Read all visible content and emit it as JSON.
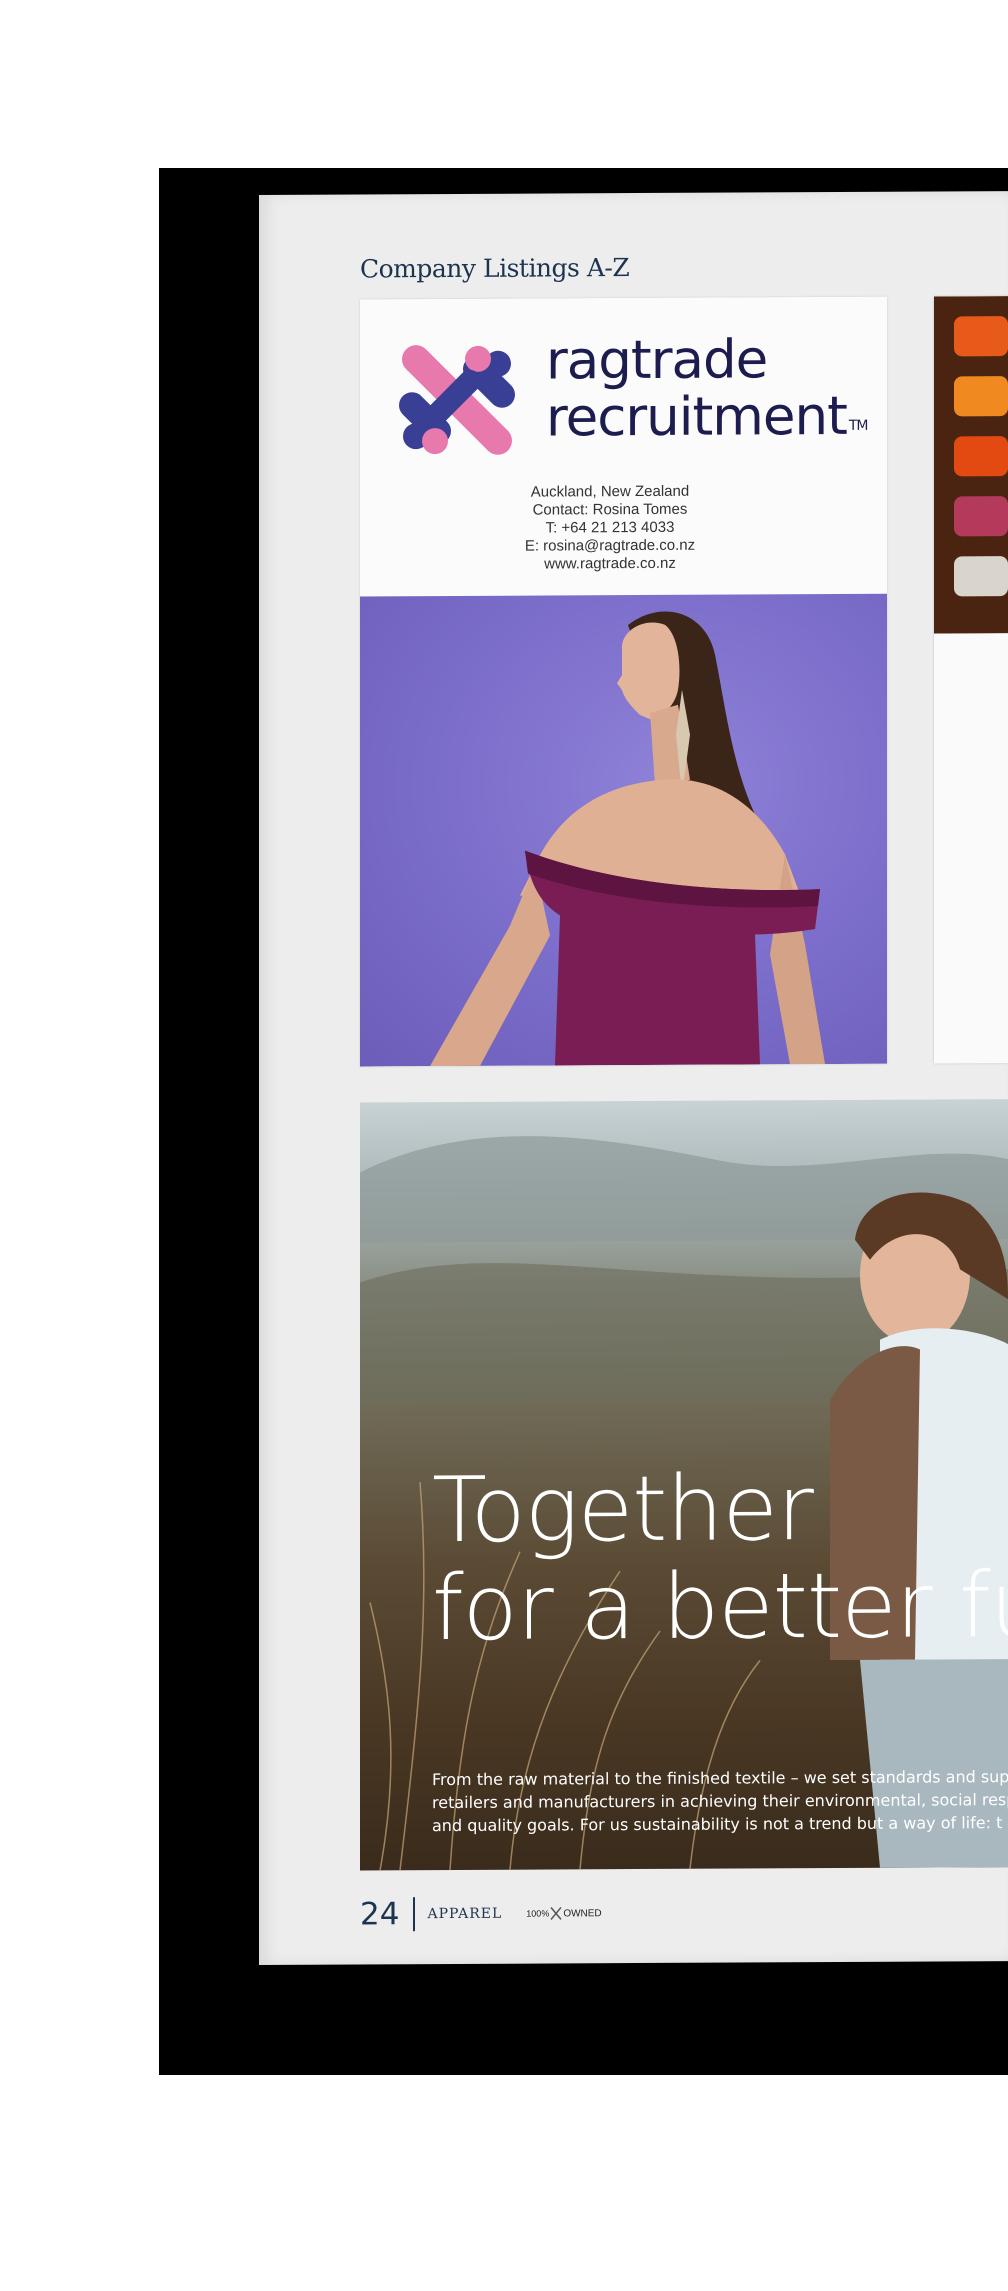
{
  "page": {
    "section_title": "Company Listings A-Z",
    "page_number": "24",
    "magazine_name": "APPAREL",
    "badge_pct": "100%",
    "badge_text": "OWNED"
  },
  "ad_ragtrade": {
    "brand_line1": "ragtrade",
    "brand_line2": "recruitment",
    "trademark": "TM",
    "location": "Auckland, New Zealand",
    "contact": "Contact: Rosina Tomes",
    "phone": "T: +64 21 213 4033",
    "email": "E: rosina@ragtrade.co.nz",
    "website": "www.ragtrade.co.nz",
    "logo_colors": {
      "pink": "#e879ac",
      "navy": "#3a3f96"
    },
    "photo_bg": "#7e70cf",
    "dress_color": "#7a1d55"
  },
  "ad_textile": {
    "headline_line1": "Together",
    "headline_line2": "for a better fu",
    "body_line1": "From the raw material to the finished textile – we set standards and suppo",
    "body_line2": "retailers and manufacturers in achieving their environmental, social respo",
    "body_line3": "and quality goals. For us sustainability is not a trend but a way of life: t"
  }
}
